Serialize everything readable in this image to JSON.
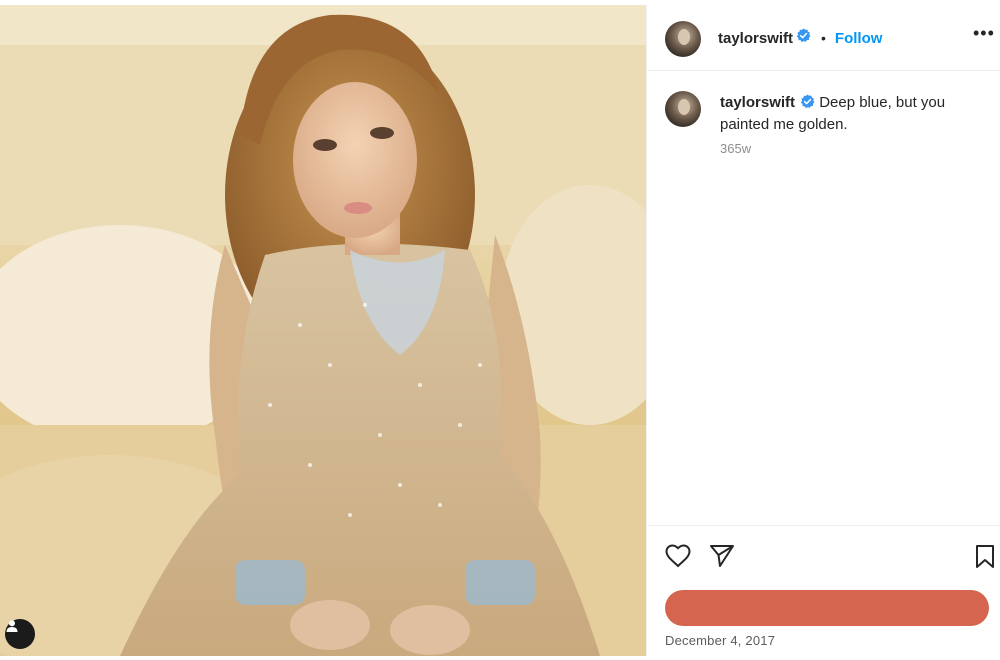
{
  "post": {
    "author": {
      "username": "taylorswift",
      "verified": true,
      "follow_label": "Follow"
    },
    "more_label": "•••",
    "caption": {
      "username": "taylorswift",
      "text": "Deep blue, but you painted me golden.",
      "age": "365w"
    },
    "date": "December 4, 2017",
    "likes_redacted": true
  },
  "icons": {
    "user_tag": "person-tag-icon",
    "verified": "verified-badge-icon",
    "like": "heart-outline-icon",
    "share": "paper-plane-icon",
    "save": "bookmark-outline-icon",
    "more": "more-options-icon"
  },
  "colors": {
    "accent": "#0095f6",
    "verified": "#3897f0",
    "redaction": "#d5654f",
    "muted_text": "#8e8e8e"
  }
}
